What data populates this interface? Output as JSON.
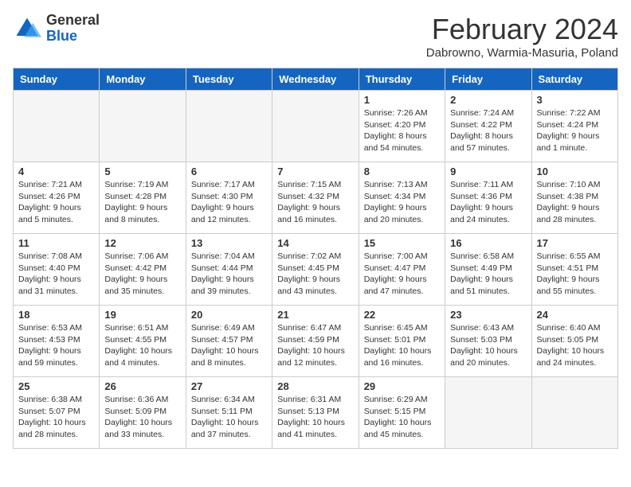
{
  "header": {
    "logo_general": "General",
    "logo_blue": "Blue",
    "month_title": "February 2024",
    "location": "Dabrowno, Warmia-Masuria, Poland"
  },
  "days_of_week": [
    "Sunday",
    "Monday",
    "Tuesday",
    "Wednesday",
    "Thursday",
    "Friday",
    "Saturday"
  ],
  "weeks": [
    [
      {
        "day": "",
        "empty": true
      },
      {
        "day": "",
        "empty": true
      },
      {
        "day": "",
        "empty": true
      },
      {
        "day": "",
        "empty": true
      },
      {
        "day": "1",
        "sunrise": "7:26 AM",
        "sunset": "4:20 PM",
        "daylight": "8 hours and 54 minutes."
      },
      {
        "day": "2",
        "sunrise": "7:24 AM",
        "sunset": "4:22 PM",
        "daylight": "8 hours and 57 minutes."
      },
      {
        "day": "3",
        "sunrise": "7:22 AM",
        "sunset": "4:24 PM",
        "daylight": "9 hours and 1 minute."
      }
    ],
    [
      {
        "day": "4",
        "sunrise": "7:21 AM",
        "sunset": "4:26 PM",
        "daylight": "9 hours and 5 minutes."
      },
      {
        "day": "5",
        "sunrise": "7:19 AM",
        "sunset": "4:28 PM",
        "daylight": "9 hours and 8 minutes."
      },
      {
        "day": "6",
        "sunrise": "7:17 AM",
        "sunset": "4:30 PM",
        "daylight": "9 hours and 12 minutes."
      },
      {
        "day": "7",
        "sunrise": "7:15 AM",
        "sunset": "4:32 PM",
        "daylight": "9 hours and 16 minutes."
      },
      {
        "day": "8",
        "sunrise": "7:13 AM",
        "sunset": "4:34 PM",
        "daylight": "9 hours and 20 minutes."
      },
      {
        "day": "9",
        "sunrise": "7:11 AM",
        "sunset": "4:36 PM",
        "daylight": "9 hours and 24 minutes."
      },
      {
        "day": "10",
        "sunrise": "7:10 AM",
        "sunset": "4:38 PM",
        "daylight": "9 hours and 28 minutes."
      }
    ],
    [
      {
        "day": "11",
        "sunrise": "7:08 AM",
        "sunset": "4:40 PM",
        "daylight": "9 hours and 31 minutes."
      },
      {
        "day": "12",
        "sunrise": "7:06 AM",
        "sunset": "4:42 PM",
        "daylight": "9 hours and 35 minutes."
      },
      {
        "day": "13",
        "sunrise": "7:04 AM",
        "sunset": "4:44 PM",
        "daylight": "9 hours and 39 minutes."
      },
      {
        "day": "14",
        "sunrise": "7:02 AM",
        "sunset": "4:45 PM",
        "daylight": "9 hours and 43 minutes."
      },
      {
        "day": "15",
        "sunrise": "7:00 AM",
        "sunset": "4:47 PM",
        "daylight": "9 hours and 47 minutes."
      },
      {
        "day": "16",
        "sunrise": "6:58 AM",
        "sunset": "4:49 PM",
        "daylight": "9 hours and 51 minutes."
      },
      {
        "day": "17",
        "sunrise": "6:55 AM",
        "sunset": "4:51 PM",
        "daylight": "9 hours and 55 minutes."
      }
    ],
    [
      {
        "day": "18",
        "sunrise": "6:53 AM",
        "sunset": "4:53 PM",
        "daylight": "9 hours and 59 minutes."
      },
      {
        "day": "19",
        "sunrise": "6:51 AM",
        "sunset": "4:55 PM",
        "daylight": "10 hours and 4 minutes."
      },
      {
        "day": "20",
        "sunrise": "6:49 AM",
        "sunset": "4:57 PM",
        "daylight": "10 hours and 8 minutes."
      },
      {
        "day": "21",
        "sunrise": "6:47 AM",
        "sunset": "4:59 PM",
        "daylight": "10 hours and 12 minutes."
      },
      {
        "day": "22",
        "sunrise": "6:45 AM",
        "sunset": "5:01 PM",
        "daylight": "10 hours and 16 minutes."
      },
      {
        "day": "23",
        "sunrise": "6:43 AM",
        "sunset": "5:03 PM",
        "daylight": "10 hours and 20 minutes."
      },
      {
        "day": "24",
        "sunrise": "6:40 AM",
        "sunset": "5:05 PM",
        "daylight": "10 hours and 24 minutes."
      }
    ],
    [
      {
        "day": "25",
        "sunrise": "6:38 AM",
        "sunset": "5:07 PM",
        "daylight": "10 hours and 28 minutes."
      },
      {
        "day": "26",
        "sunrise": "6:36 AM",
        "sunset": "5:09 PM",
        "daylight": "10 hours and 33 minutes."
      },
      {
        "day": "27",
        "sunrise": "6:34 AM",
        "sunset": "5:11 PM",
        "daylight": "10 hours and 37 minutes."
      },
      {
        "day": "28",
        "sunrise": "6:31 AM",
        "sunset": "5:13 PM",
        "daylight": "10 hours and 41 minutes."
      },
      {
        "day": "29",
        "sunrise": "6:29 AM",
        "sunset": "5:15 PM",
        "daylight": "10 hours and 45 minutes."
      },
      {
        "day": "",
        "empty": true
      },
      {
        "day": "",
        "empty": true
      }
    ]
  ]
}
